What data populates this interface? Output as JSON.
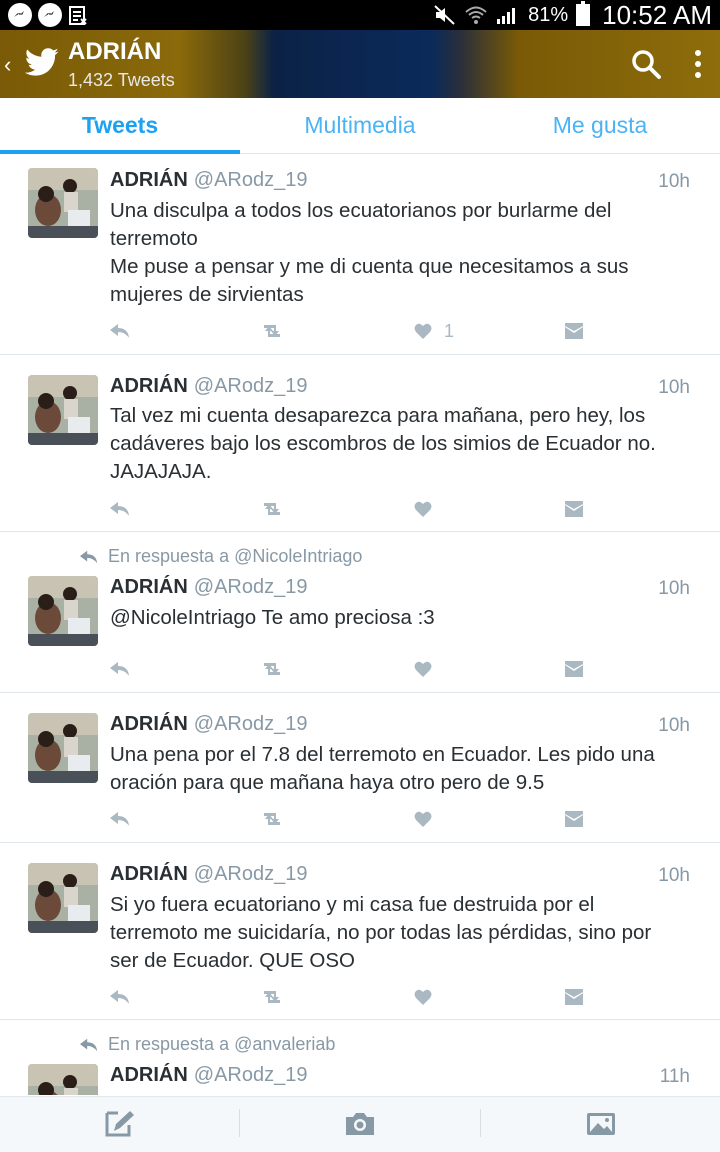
{
  "status_bar": {
    "battery": "81%",
    "time": "10:52 AM",
    "icons": [
      "messenger-icon",
      "messenger-icon",
      "clipboard-icon",
      "mute-icon",
      "wifi-icon",
      "signal-icon",
      "battery-icon"
    ]
  },
  "header": {
    "title": "ADRIÁN",
    "tweet_count": "1,432 Tweets"
  },
  "tabs": [
    {
      "label": "Tweets",
      "active": true
    },
    {
      "label": "Multimedia",
      "active": false
    },
    {
      "label": "Me gusta",
      "active": false
    }
  ],
  "tweets": [
    {
      "reply_to": "",
      "name": "ADRIÁN",
      "handle": "@ARodz_19",
      "time": "10h",
      "text": "Una disculpa a todos los ecuatorianos por burlarme del\nterremoto\nMe puse a pensar y me di cuenta que necesitamos a sus\nmujeres de sirvientas",
      "likes": "1"
    },
    {
      "reply_to": "",
      "name": "ADRIÁN",
      "handle": "@ARodz_19",
      "time": "10h",
      "text": "Tal vez mi cuenta desaparezca para mañana, pero hey, los\ncadáveres bajo los escombros de los simios de Ecuador no.\nJAJAJAJA.",
      "likes": ""
    },
    {
      "reply_to": "En respuesta a @NicoleIntriago",
      "name": "ADRIÁN",
      "handle": "@ARodz_19",
      "time": "10h",
      "text": "@NicoleIntriago Te amo preciosa :3",
      "likes": ""
    },
    {
      "reply_to": "",
      "name": "ADRIÁN",
      "handle": "@ARodz_19",
      "time": "10h",
      "text": "Una pena por el 7.8 del terremoto en Ecuador. Les pido una\noración para que mañana haya otro pero de 9.5",
      "likes": ""
    },
    {
      "reply_to": "",
      "name": "ADRIÁN",
      "handle": "@ARodz_19",
      "time": "10h",
      "text": "Si yo fuera ecuatoriano y mi casa fue destruida por el\nterremoto me suicidaría, no por todas las pérdidas, sino por\nser de Ecuador. QUE OSO",
      "likes": ""
    },
    {
      "reply_to": "En respuesta a @anvaleriab",
      "name": "ADRIÁN",
      "handle": "@ARodz_19",
      "time": "11h",
      "text": "",
      "likes": ""
    }
  ],
  "colors": {
    "accent": "#1da1f2",
    "muted": "#8899a6",
    "action_icon": "#aab8c2"
  }
}
